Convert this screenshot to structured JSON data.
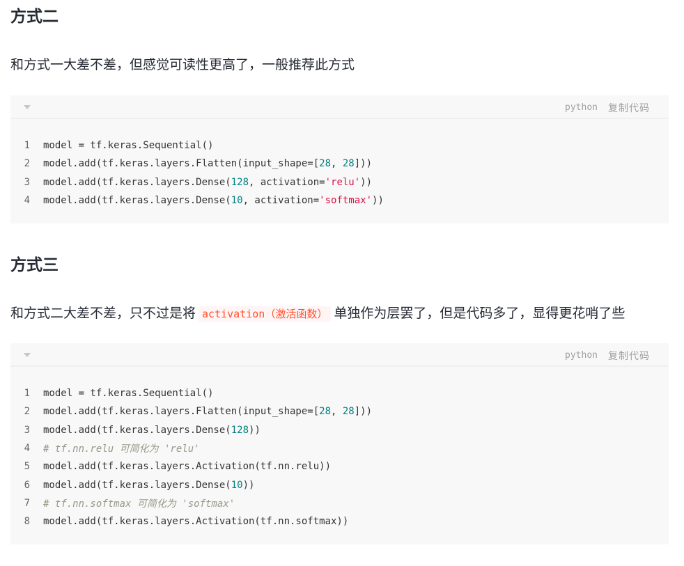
{
  "section2": {
    "heading": "方式二",
    "description": "和方式一大差不差，但感觉可读性更高了，一般推荐此方式",
    "code": {
      "language": "python",
      "copy_label": "复制代码",
      "lines": [
        {
          "no": "1",
          "parts": [
            {
              "t": "plain",
              "v": "model = tf.keras.Sequential()"
            }
          ]
        },
        {
          "no": "2",
          "parts": [
            {
              "t": "plain",
              "v": "model.add(tf.keras.layers.Flatten(input_shape=["
            },
            {
              "t": "num",
              "v": "28"
            },
            {
              "t": "plain",
              "v": ", "
            },
            {
              "t": "num",
              "v": "28"
            },
            {
              "t": "plain",
              "v": "]))"
            }
          ]
        },
        {
          "no": "3",
          "parts": [
            {
              "t": "plain",
              "v": "model.add(tf.keras.layers.Dense("
            },
            {
              "t": "num",
              "v": "128"
            },
            {
              "t": "plain",
              "v": ", activation="
            },
            {
              "t": "str",
              "v": "'relu'"
            },
            {
              "t": "plain",
              "v": "))"
            }
          ]
        },
        {
          "no": "4",
          "parts": [
            {
              "t": "plain",
              "v": "model.add(tf.keras.layers.Dense("
            },
            {
              "t": "num",
              "v": "10"
            },
            {
              "t": "plain",
              "v": ", activation="
            },
            {
              "t": "str",
              "v": "'softmax'"
            },
            {
              "t": "plain",
              "v": "))"
            }
          ]
        }
      ]
    }
  },
  "section3": {
    "heading": "方式三",
    "description_before": "和方式二大差不差，只不过是将",
    "inline_code": "activation（激活函数）",
    "description_after": "单独作为层罢了，但是代码多了，显得更花哨了些",
    "code": {
      "language": "python",
      "copy_label": "复制代码",
      "lines": [
        {
          "no": "1",
          "parts": [
            {
              "t": "plain",
              "v": "model = tf.keras.Sequential()"
            }
          ]
        },
        {
          "no": "2",
          "parts": [
            {
              "t": "plain",
              "v": "model.add(tf.keras.layers.Flatten(input_shape=["
            },
            {
              "t": "num",
              "v": "28"
            },
            {
              "t": "plain",
              "v": ", "
            },
            {
              "t": "num",
              "v": "28"
            },
            {
              "t": "plain",
              "v": "]))"
            }
          ]
        },
        {
          "no": "3",
          "parts": [
            {
              "t": "plain",
              "v": "model.add(tf.keras.layers.Dense("
            },
            {
              "t": "num",
              "v": "128"
            },
            {
              "t": "plain",
              "v": "))"
            }
          ]
        },
        {
          "no": "4",
          "parts": [
            {
              "t": "cmt",
              "v": "# tf.nn.relu 可简化为 'relu'"
            }
          ]
        },
        {
          "no": "5",
          "parts": [
            {
              "t": "plain",
              "v": "model.add(tf.keras.layers.Activation(tf.nn.relu))"
            }
          ]
        },
        {
          "no": "6",
          "parts": [
            {
              "t": "plain",
              "v": "model.add(tf.keras.layers.Dense("
            },
            {
              "t": "num",
              "v": "10"
            },
            {
              "t": "plain",
              "v": "))"
            }
          ]
        },
        {
          "no": "7",
          "parts": [
            {
              "t": "cmt",
              "v": "# tf.nn.softmax 可简化为 'softmax'"
            }
          ]
        },
        {
          "no": "8",
          "parts": [
            {
              "t": "plain",
              "v": "model.add(tf.keras.layers.Activation(tf.nn.softmax))"
            }
          ]
        }
      ]
    }
  }
}
